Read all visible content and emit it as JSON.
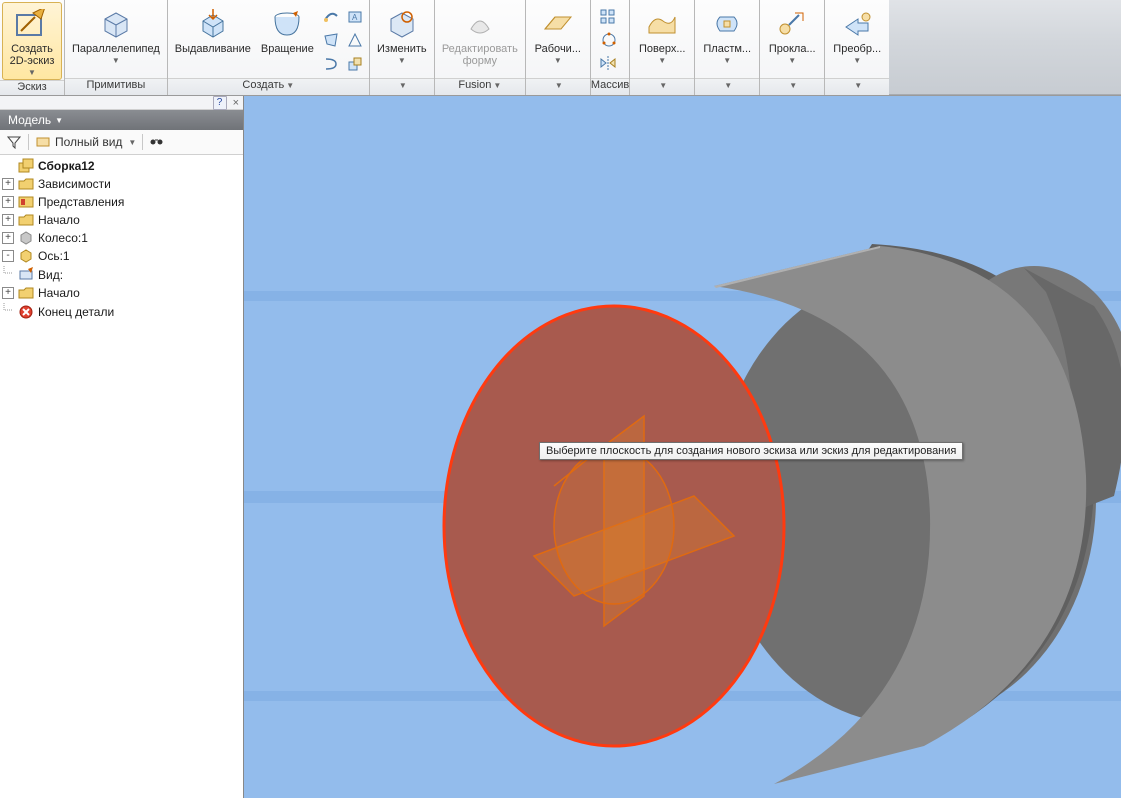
{
  "ribbon": {
    "groups": [
      {
        "label": "Эскиз",
        "buttons": [
          {
            "label": "Создать\n2D-эскиз",
            "name": "create-2d-sketch-button",
            "icon": "sketch",
            "split": true,
            "active": true
          }
        ]
      },
      {
        "label": "Примитивы",
        "buttons": [
          {
            "label": "Параллелепипед",
            "name": "box-primitive-button",
            "icon": "box",
            "split": true
          }
        ]
      },
      {
        "label": "Создать",
        "dropdown": true,
        "buttons": [
          {
            "label": "Выдавливание",
            "name": "extrude-button",
            "icon": "extrude"
          },
          {
            "label": "Вращение",
            "name": "revolve-button",
            "icon": "revolve"
          }
        ],
        "mini": [
          "sweep",
          "emboss",
          "loft",
          "rib",
          "coil",
          "derive"
        ]
      },
      {
        "label": "",
        "anon_dropdown": true,
        "buttons": [
          {
            "label": "Изменить",
            "name": "modify-button",
            "icon": "modify",
            "split": true
          }
        ]
      },
      {
        "label": "Fusion",
        "anon_dropdown": true,
        "buttons": [
          {
            "label": "Редактировать\nформу",
            "name": "edit-form-button",
            "icon": "editform",
            "disabled": true
          }
        ]
      },
      {
        "label": "",
        "anon_dropdown": true,
        "buttons": [
          {
            "label": "Рабочи...",
            "name": "work-features-button",
            "icon": "plane",
            "split": true
          }
        ]
      },
      {
        "label": "Массив",
        "mini_only": true,
        "mini": [
          "rect-pattern",
          "circ-pattern",
          "mirror"
        ]
      },
      {
        "label": "",
        "anon_dropdown": true,
        "buttons": [
          {
            "label": "Поверх...",
            "name": "surface-button",
            "icon": "surface",
            "split": true
          }
        ]
      },
      {
        "label": "",
        "anon_dropdown": true,
        "buttons": [
          {
            "label": "Пластм...",
            "name": "plastic-button",
            "icon": "plastic",
            "split": true
          }
        ]
      },
      {
        "label": "",
        "anon_dropdown": true,
        "buttons": [
          {
            "label": "Прокла...",
            "name": "harness-button",
            "icon": "harness",
            "split": true
          }
        ]
      },
      {
        "label": "",
        "anon_dropdown": true,
        "buttons": [
          {
            "label": "Преобр...",
            "name": "convert-button",
            "icon": "convert",
            "split": true
          }
        ]
      }
    ]
  },
  "browser": {
    "close_label": "×",
    "help_label": "?",
    "title": "Модель",
    "view_mode": "Полный вид",
    "nodes": [
      {
        "depth": 1,
        "twisty": "",
        "icon": "assembly",
        "label": "Сборка12",
        "bold": true,
        "name": "tree-root-assembly"
      },
      {
        "depth": 2,
        "twisty": "+",
        "icon": "folder",
        "label": "Зависимости",
        "name": "tree-item-constraints"
      },
      {
        "depth": 2,
        "twisty": "+",
        "icon": "representations",
        "label": "Представления",
        "name": "tree-item-representations"
      },
      {
        "depth": 2,
        "twisty": "+",
        "icon": "folder",
        "label": "Начало",
        "name": "tree-item-origin"
      },
      {
        "depth": 2,
        "twisty": "+",
        "icon": "part-grey",
        "label": "Колесо:1",
        "name": "tree-item-wheel"
      },
      {
        "depth": 2,
        "twisty": "-",
        "icon": "part",
        "label": "Ось:1",
        "name": "tree-item-axis"
      },
      {
        "depth": 3,
        "twisty": "",
        "icon": "view",
        "label": "Вид:",
        "name": "tree-item-view",
        "tail": true
      },
      {
        "depth": 3,
        "twisty": "+",
        "icon": "folder",
        "label": "Начало",
        "name": "tree-item-axis-origin"
      },
      {
        "depth": 3,
        "twisty": "",
        "icon": "end",
        "label": "Конец детали",
        "name": "tree-item-end-of-part",
        "tail": true
      }
    ]
  },
  "viewport": {
    "tooltip": "Выберите плоскость для создания нового эскиза или эскиз для редактирования"
  }
}
